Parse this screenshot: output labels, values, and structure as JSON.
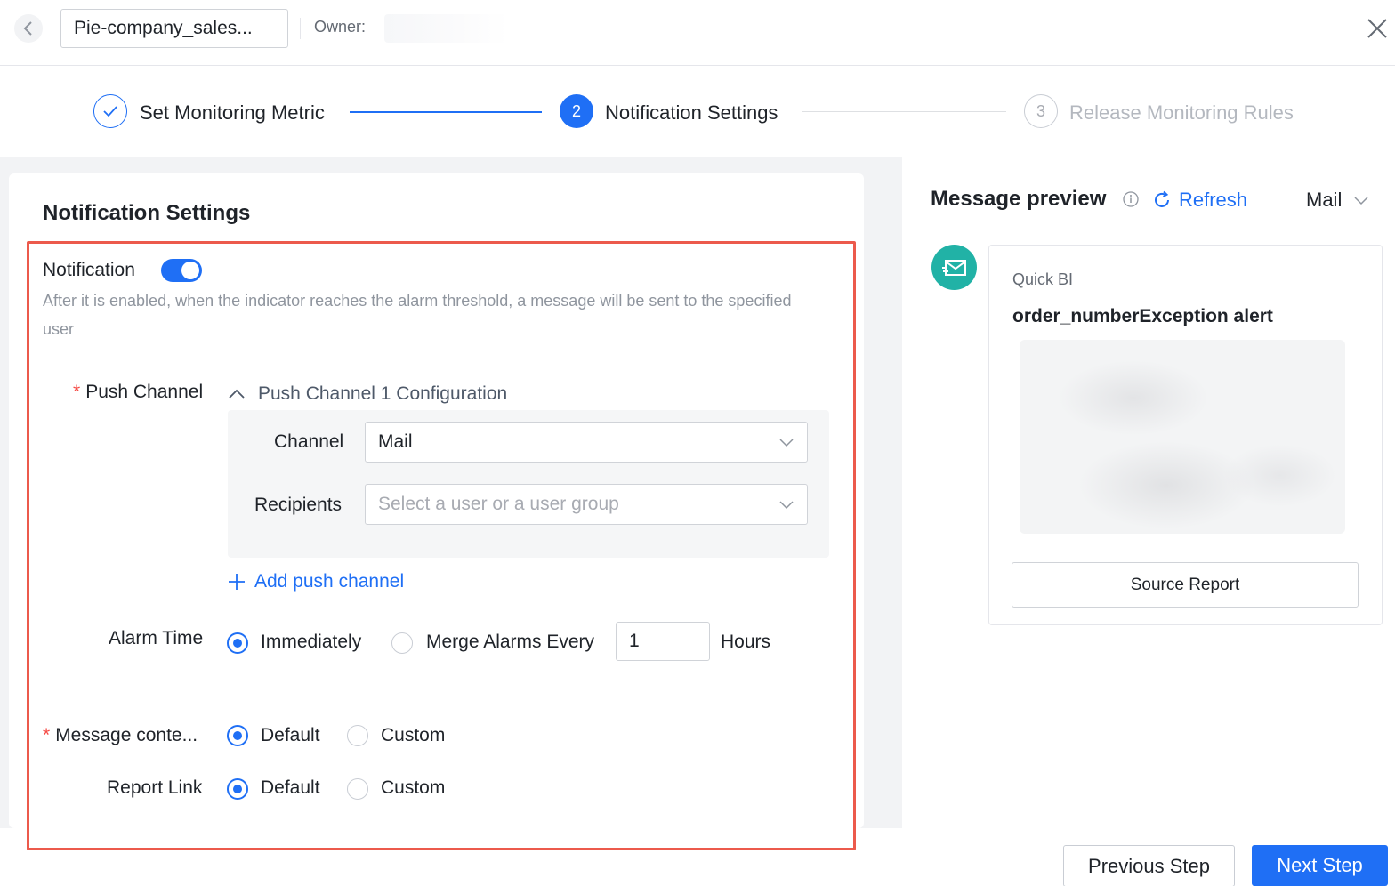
{
  "header": {
    "report_name": "Pie-company_sales...",
    "owner_label": "Owner:"
  },
  "stepper": {
    "steps": [
      {
        "number": "1",
        "label": "Set Monitoring Metric",
        "state": "done"
      },
      {
        "number": "2",
        "label": "Notification Settings",
        "state": "active"
      },
      {
        "number": "3",
        "label": "Release Monitoring Rules",
        "state": "pending"
      }
    ]
  },
  "form": {
    "title": "Notification Settings",
    "notification_label": "Notification",
    "notification_enabled": true,
    "notification_hint": "After it is enabled, when the indicator reaches the alarm threshold, a message will be sent to the specified user",
    "push_channel_label": "Push Channel",
    "push_channel_config_title": "Push Channel 1 Configuration",
    "channel_label": "Channel",
    "channel_value": "Mail",
    "recipients_label": "Recipients",
    "recipients_placeholder": "Select a user or a user group",
    "add_push_channel": "Add push channel",
    "alarm_time_label": "Alarm Time",
    "alarm_option_immediately": "Immediately",
    "alarm_option_merge": "Merge Alarms Every",
    "merge_interval_value": "1",
    "merge_interval_unit": "Hours",
    "alarm_time_selected": "Immediately",
    "message_content_label": "Message conte...",
    "message_option_default": "Default",
    "message_option_custom": "Custom",
    "message_content_selected": "Default",
    "report_link_label": "Report Link",
    "report_link_option_default": "Default",
    "report_link_option_custom": "Custom",
    "report_link_selected": "Default"
  },
  "preview": {
    "title": "Message preview",
    "refresh_label": "Refresh",
    "channel_select": "Mail",
    "sender": "Quick BI",
    "subject": "order_numberException alert",
    "source_report_button": "Source Report"
  },
  "footer": {
    "previous_step": "Previous Step",
    "next_step": "Next Step"
  },
  "colors": {
    "primary": "#1f6ff5",
    "highlight_border": "#ec5a4c",
    "avatar": "#21b2a6"
  }
}
